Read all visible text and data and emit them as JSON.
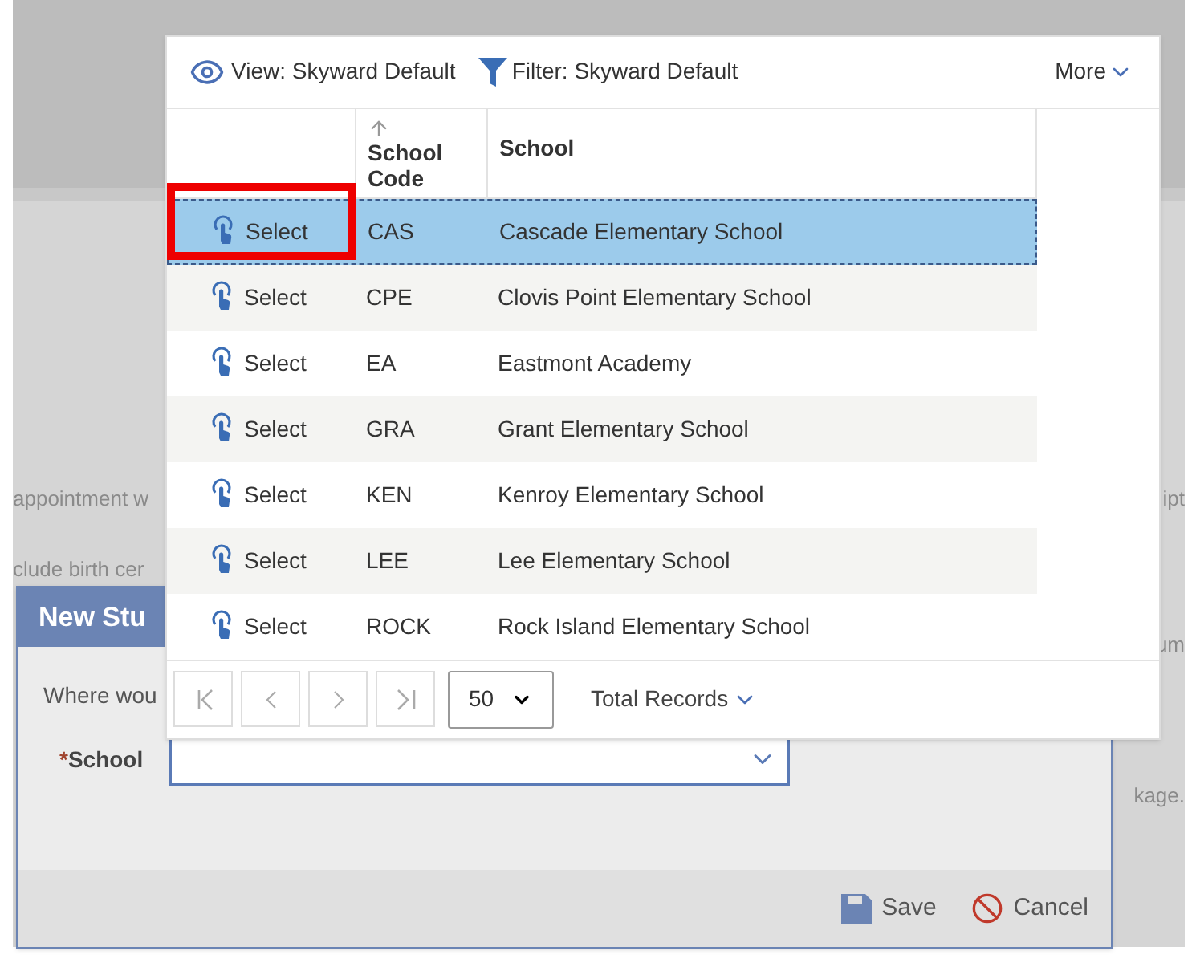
{
  "page": {
    "left_texts": [
      "appointment w",
      "clude birth cer"
    ],
    "right_texts": [
      "ipt",
      "um",
      "kage."
    ]
  },
  "dialog": {
    "title": "New Stu",
    "prompt": "Where wou",
    "field": {
      "required_mark": "*",
      "label": "School"
    },
    "buttons": [
      {
        "kind": "save",
        "label": "Save"
      },
      {
        "kind": "cancel",
        "label": "Cancel"
      }
    ]
  },
  "lookup": {
    "toolbar": {
      "view": "View: Skyward Default",
      "filter": "Filter: Skyward Default",
      "more": "More"
    },
    "columns": [
      {
        "label": "School Code",
        "sorted": true
      },
      {
        "label": "School",
        "sorted": false
      }
    ],
    "rows": [
      {
        "action": "Select",
        "code": "CAS",
        "school": "Cascade Elementary School",
        "selected": true,
        "highlighted": true
      },
      {
        "action": "Select",
        "code": "CPE",
        "school": "Clovis Point Elementary School",
        "selected": false,
        "highlighted": false
      },
      {
        "action": "Select",
        "code": "EA",
        "school": "Eastmont Academy",
        "selected": false,
        "highlighted": false
      },
      {
        "action": "Select",
        "code": "GRA",
        "school": "Grant Elementary School",
        "selected": false,
        "highlighted": false
      },
      {
        "action": "Select",
        "code": "KEN",
        "school": "Kenroy Elementary School",
        "selected": false,
        "highlighted": false
      },
      {
        "action": "Select",
        "code": "LEE",
        "school": "Lee Elementary School",
        "selected": false,
        "highlighted": false
      },
      {
        "action": "Select",
        "code": "ROCK",
        "school": "Rock Island Elementary School",
        "selected": false,
        "highlighted": false
      }
    ],
    "pager": {
      "page_size": "50",
      "total": "Total Records"
    }
  }
}
